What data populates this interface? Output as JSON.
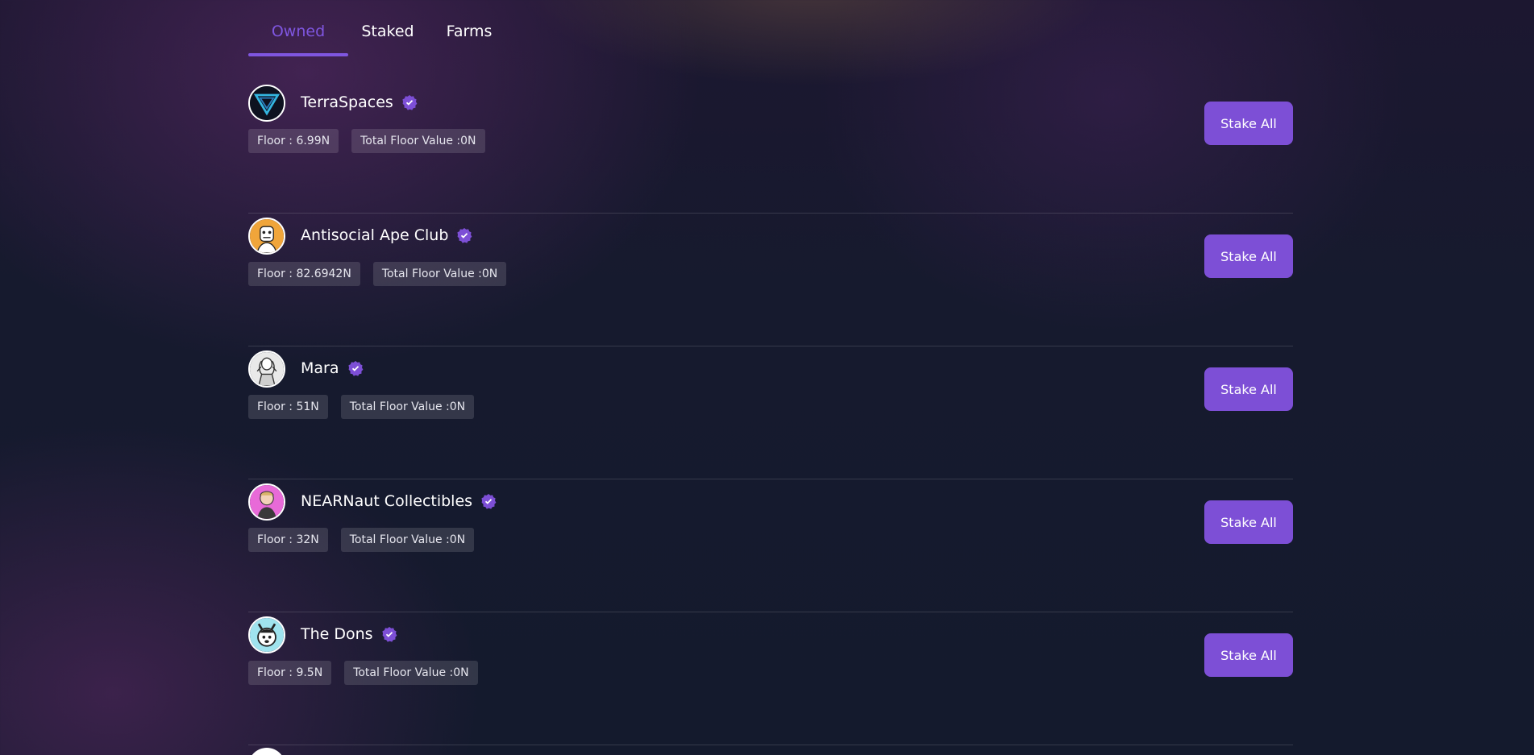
{
  "tabs": {
    "owned": "Owned",
    "staked": "Staked",
    "farms": "Farms"
  },
  "collections": [
    {
      "name": "TerraSpaces",
      "floor": "Floor : 6.99N",
      "total": "Total Floor Value :0N",
      "action": "Stake All",
      "icon": "terraspaces-logo-icon"
    },
    {
      "name": "Antisocial Ape Club",
      "floor": "Floor : 82.6942N",
      "total": "Total Floor Value :0N",
      "action": "Stake All",
      "icon": "antisocial-ape-avatar-icon"
    },
    {
      "name": "Mara",
      "floor": "Floor : 51N",
      "total": "Total Floor Value :0N",
      "action": "Stake All",
      "icon": "mara-avatar-icon"
    },
    {
      "name": "NEARNaut Collectibles",
      "floor": "Floor : 32N",
      "total": "Total Floor Value :0N",
      "action": "Stake All",
      "icon": "nearnaut-avatar-icon"
    },
    {
      "name": "The Dons",
      "floor": "Floor : 9.5N",
      "total": "Total Floor Value :0N",
      "action": "Stake All",
      "icon": "the-dons-avatar-icon"
    }
  ],
  "colors": {
    "accent": "#7d4fd6",
    "active_tab": "#7f56e0",
    "background": "#161a2e"
  }
}
